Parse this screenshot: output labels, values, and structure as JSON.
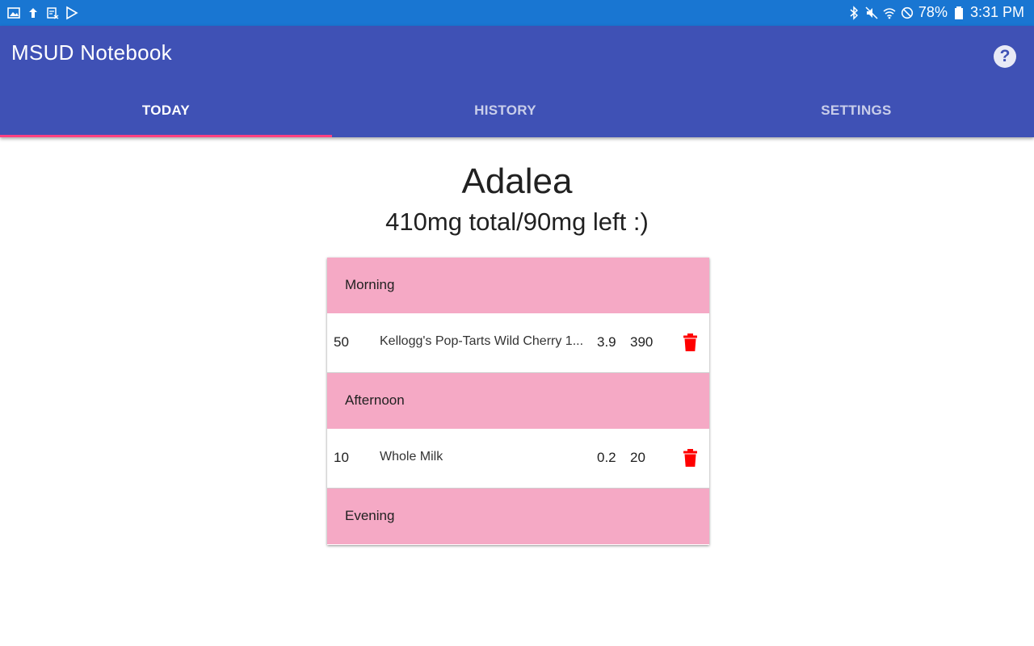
{
  "status_bar": {
    "left_icons": [
      "image-icon",
      "upload-icon",
      "calendar-icon",
      "play-store-icon"
    ],
    "right_icons": [
      "bluetooth-icon",
      "mute-icon",
      "wifi-icon",
      "dnd-icon",
      "battery-icon"
    ],
    "battery": "78%",
    "time": "3:31 PM"
  },
  "app_bar": {
    "title": "MSUD Notebook",
    "help_label": "?",
    "tabs": [
      {
        "label": "TODAY",
        "active": true
      },
      {
        "label": "HISTORY",
        "active": false
      },
      {
        "label": "SETTINGS",
        "active": false
      }
    ],
    "indicator_color": "#ff4081"
  },
  "main": {
    "name": "Adalea",
    "summary": "410mg total/90mg left :)"
  },
  "log": {
    "sections": [
      {
        "label": "Morning"
      },
      {
        "label": "Afternoon"
      },
      {
        "label": "Evening"
      }
    ],
    "entries": [
      {
        "qty": "50",
        "food": "Kellogg's Pop-Tarts Wild Cherry 1...",
        "leucine_per": "3.9",
        "leucine_total": "390",
        "delete_icon": "trash-icon"
      },
      {
        "qty": "10",
        "food": "Whole Milk",
        "leucine_per": "0.2",
        "leucine_total": "20",
        "delete_icon": "trash-icon"
      }
    ]
  },
  "colors": {
    "status_bar": "#1976d2",
    "app_bar": "#3f51b5",
    "section_header": "#f5a9c5",
    "delete": "#ff0000"
  }
}
